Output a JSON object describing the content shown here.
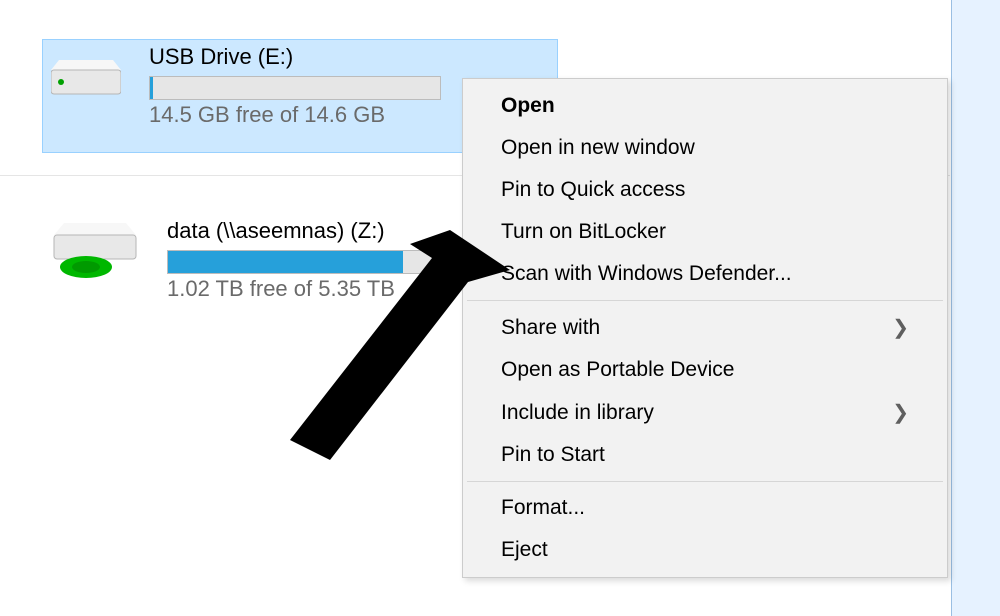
{
  "drives": {
    "usb": {
      "name": "USB Drive (E:)",
      "free": "14.5 GB free of 14.6 GB",
      "used_pct": 1
    },
    "net": {
      "name": "data (\\\\aseemnas) (Z:)",
      "free": "1.02 TB free of 5.35 TB",
      "used_pct": 81
    }
  },
  "context_menu": {
    "open": "Open",
    "open_new": "Open in new window",
    "pin_quick": "Pin to Quick access",
    "bitlocker": "Turn on BitLocker",
    "defender": "Scan with Windows Defender...",
    "share": "Share with",
    "portable": "Open as Portable Device",
    "library": "Include in library",
    "pin_start": "Pin to Start",
    "format": "Format...",
    "eject": "Eject"
  }
}
